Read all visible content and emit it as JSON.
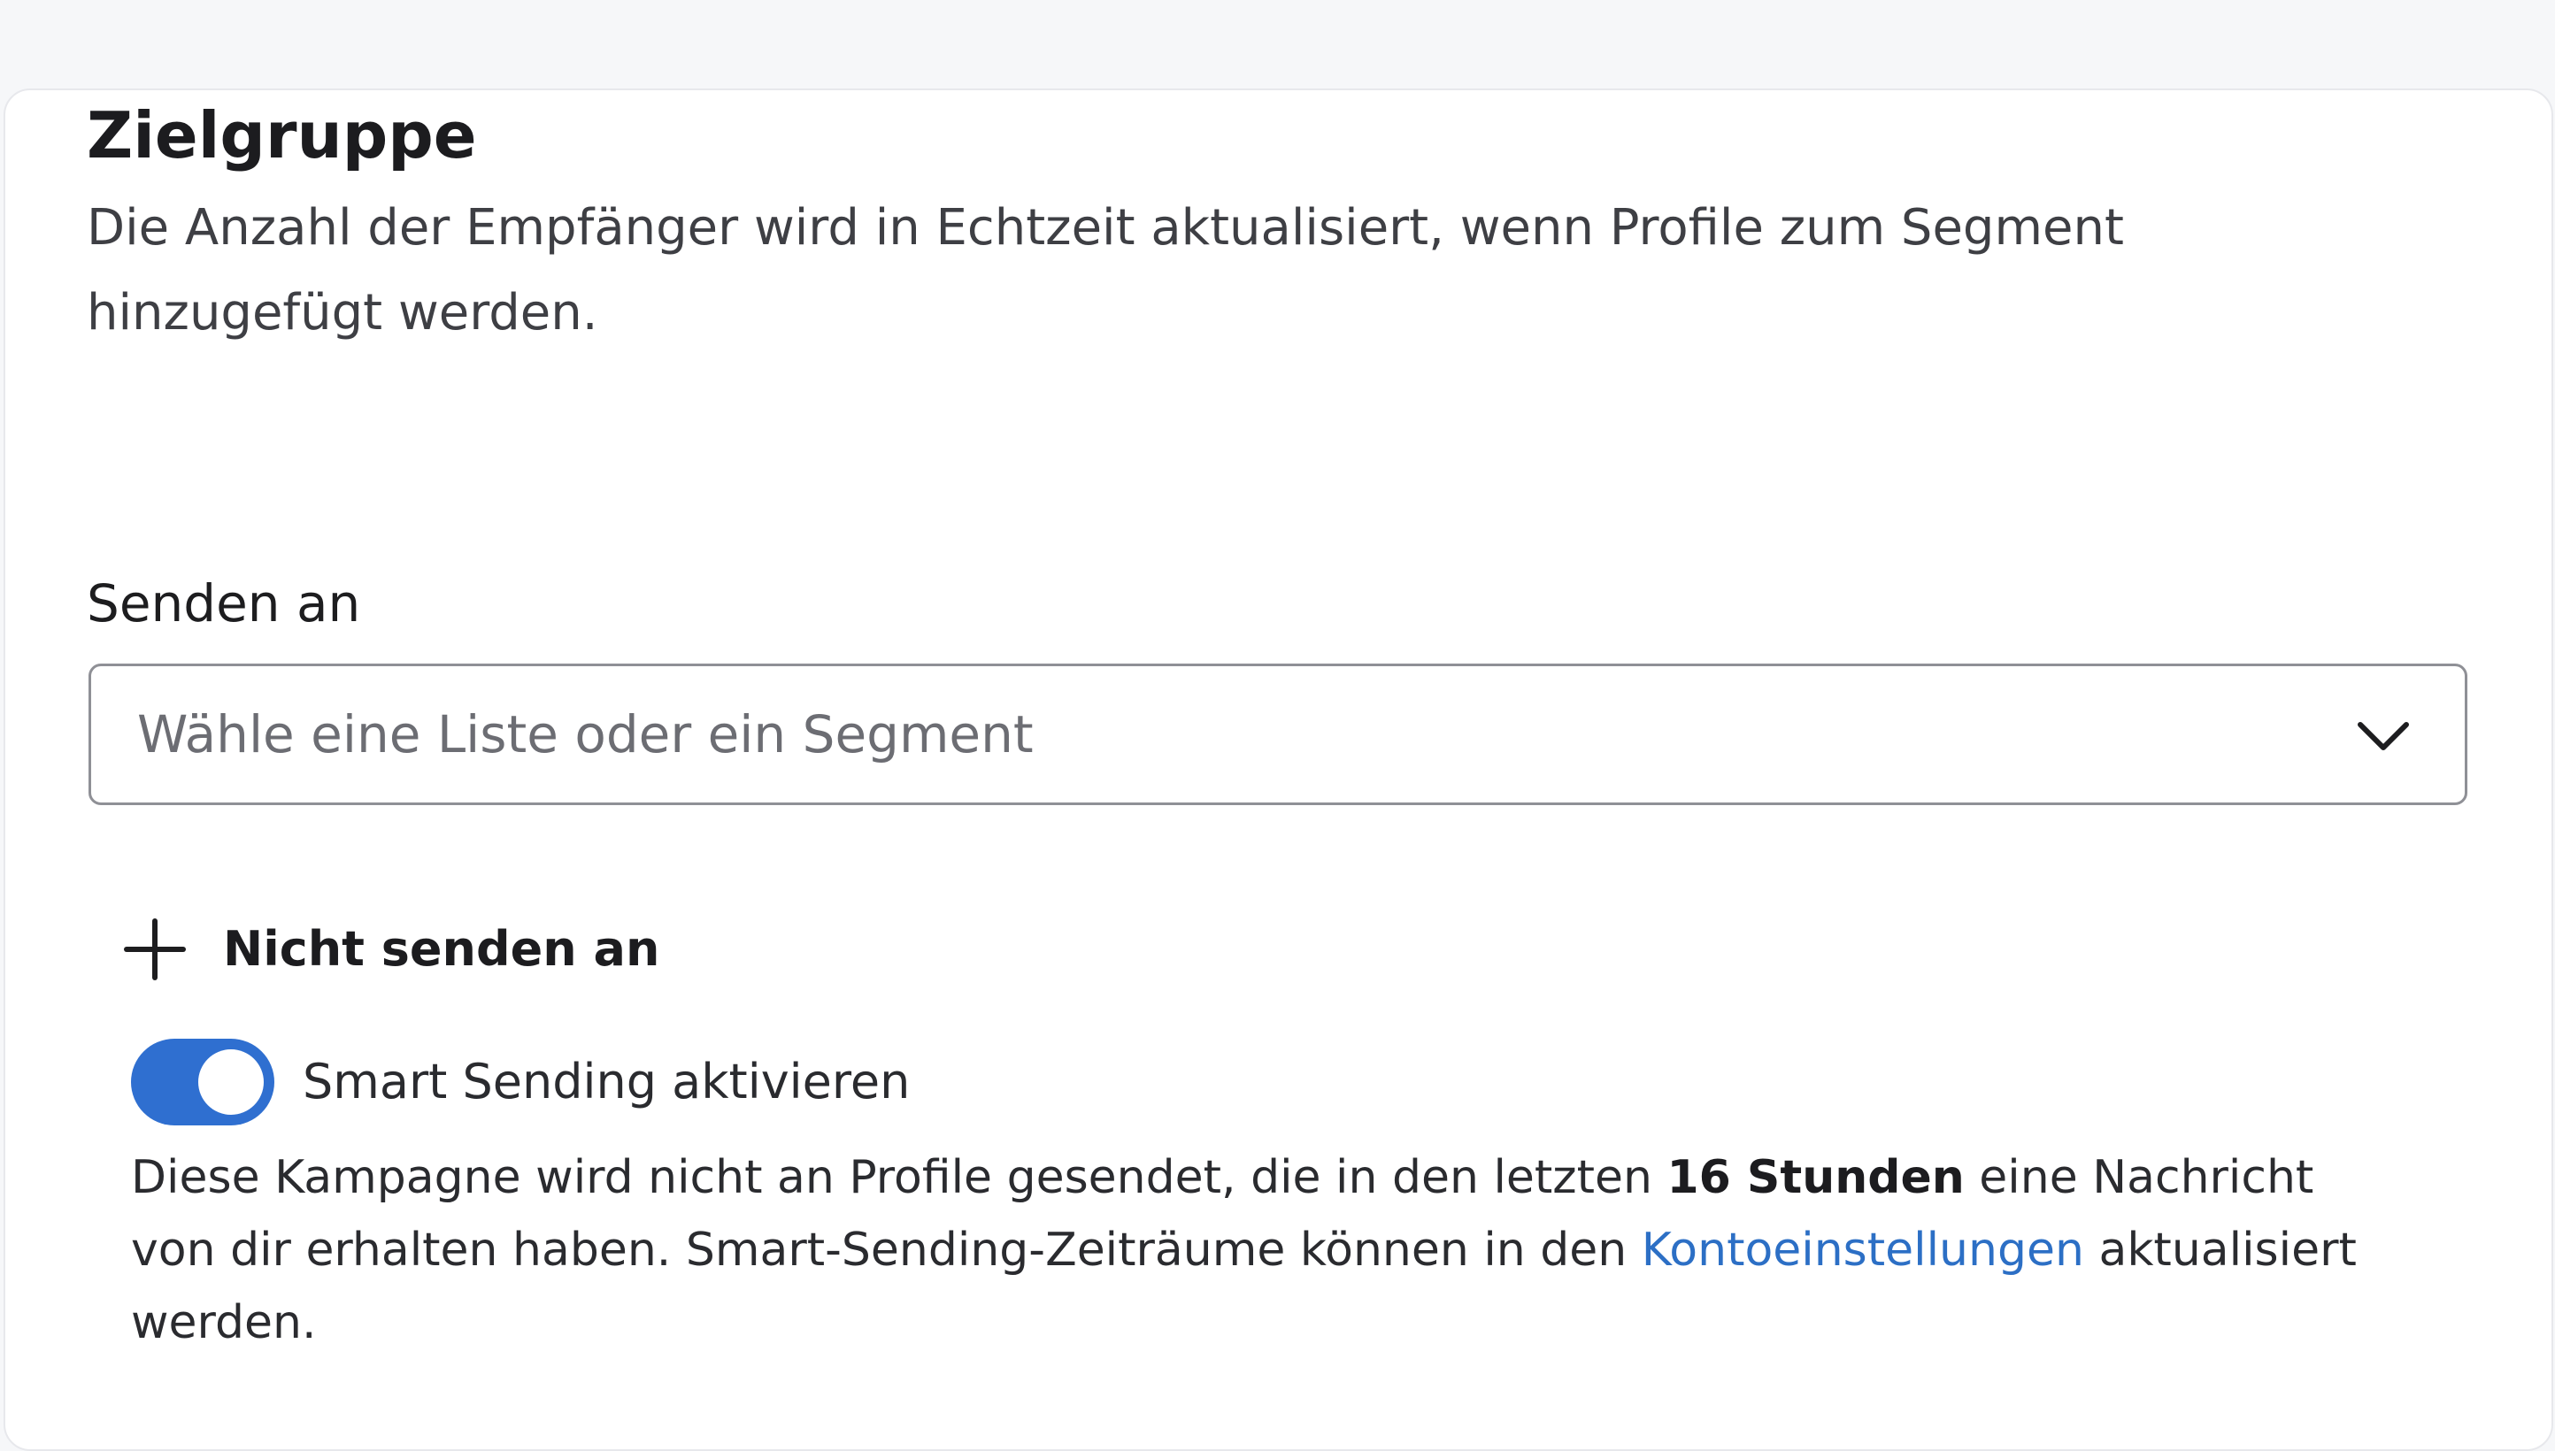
{
  "audience": {
    "title": "Zielgruppe",
    "description": "Die Anzahl der Empfänger wird in Echtzeit aktualisiert, wenn Profile zum Segment hinzugefügt werden.",
    "send_to": {
      "label": "Senden an",
      "placeholder": "Wähle eine Liste oder ein Segment",
      "icon": "chevron-down-icon"
    },
    "exclude": {
      "label": "Nicht senden an",
      "icon": "plus-icon"
    },
    "smart_sending": {
      "label": "Smart Sending aktivieren",
      "enabled": true,
      "accent_color": "#2f6fd0",
      "note_prefix": "Diese Kampagne wird nicht an Profile gesendet, die in den letzten ",
      "note_bold": "16 Stunden",
      "note_middle": " eine Nachricht von dir erhalten haben. Smart-Sending-Zeiträume können in den ",
      "note_link": "Kontoeinstellungen",
      "note_suffix": " aktualisiert werden.",
      "link_color": "#2c6fc5"
    }
  }
}
